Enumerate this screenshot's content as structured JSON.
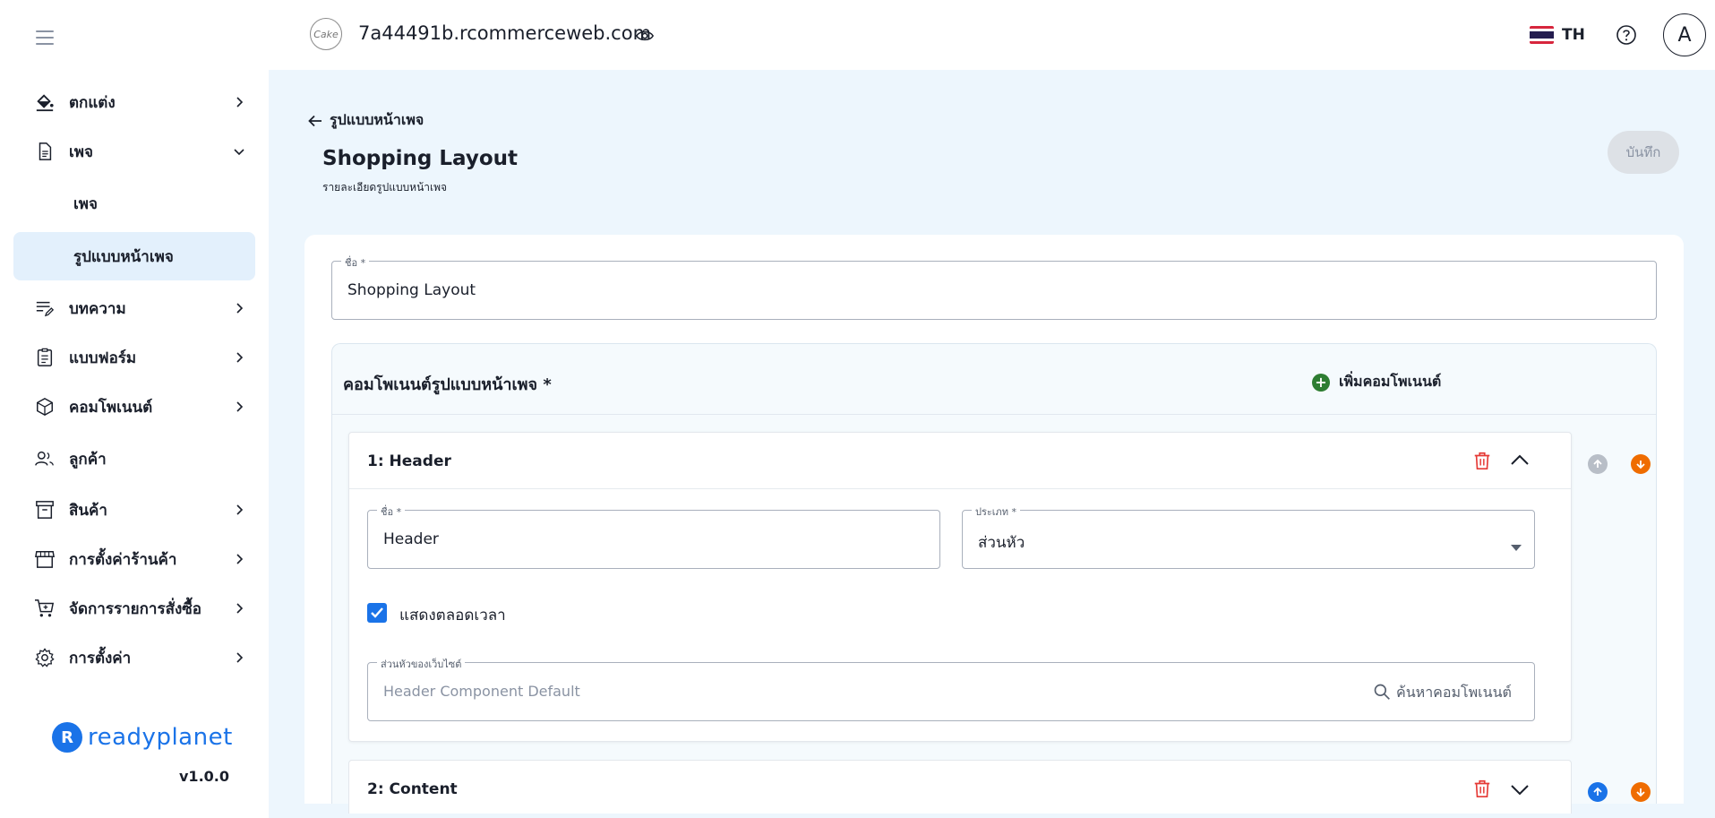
{
  "sidebar": {
    "items": [
      {
        "label": "ตกแต่ง",
        "icon": "paint-bucket-icon"
      },
      {
        "label": "เพจ",
        "icon": "document-icon"
      },
      {
        "label": "บทความ",
        "icon": "article-edit-icon"
      },
      {
        "label": "แบบฟอร์ม",
        "icon": "form-clipboard-icon"
      },
      {
        "label": "คอมโพเนนต์",
        "icon": "cube-icon"
      },
      {
        "label": "ลูกค้า",
        "icon": "users-icon"
      },
      {
        "label": "สินค้า",
        "icon": "archive-box-icon"
      },
      {
        "label": "การตั้งค่าร้านค้า",
        "icon": "storefront-icon"
      },
      {
        "label": "จัดการรายการสั่งซื้อ",
        "icon": "cart-icon"
      },
      {
        "label": "การตั้งค่า",
        "icon": "gear-icon"
      }
    ],
    "sub_items": [
      {
        "label": "เพจ"
      },
      {
        "label": "รูปแบบหน้าเพจ"
      }
    ],
    "brand": "readyplanet",
    "brand_mark": "R",
    "version": "v1.0.0"
  },
  "topbar": {
    "site_name": "7a44491b.rcommerceweb.com",
    "site_logo": "Cake",
    "lang": "TH",
    "avatar": "A"
  },
  "main": {
    "back_label": "รูปแบบหน้าเพจ",
    "title": "Shopping Layout",
    "subtitle": "รายละเอียดรูปแบบหน้าเพจ",
    "save_label": "บันทึก",
    "name_field": {
      "label": "ชื่อ *",
      "value": "Shopping Layout"
    },
    "components": {
      "title": "คอมโพเนนต์รูปแบบหน้าเพจ *",
      "add_label": "เพิ่มคอมโพเนนต์",
      "sections": [
        {
          "title": "1: Header",
          "name_field": {
            "label": "ชื่อ *",
            "value": "Header"
          },
          "type_field": {
            "label": "ประเภท *",
            "value": "ส่วนหัว"
          },
          "checkbox_label": "แสดงตลอดเวลา",
          "component_field": {
            "label": "ส่วนหัวของเว็บไซต์",
            "placeholder": "Header Component Default",
            "search_label": "ค้นหาคอมโพเนนต์"
          }
        },
        {
          "title": "2: Content"
        }
      ]
    }
  },
  "colors": {
    "accent": "#1a73e8",
    "delete": "#e53935",
    "move_down": "#ef6c00",
    "add": "#2e7d32",
    "disabled": "#b8bec7"
  }
}
